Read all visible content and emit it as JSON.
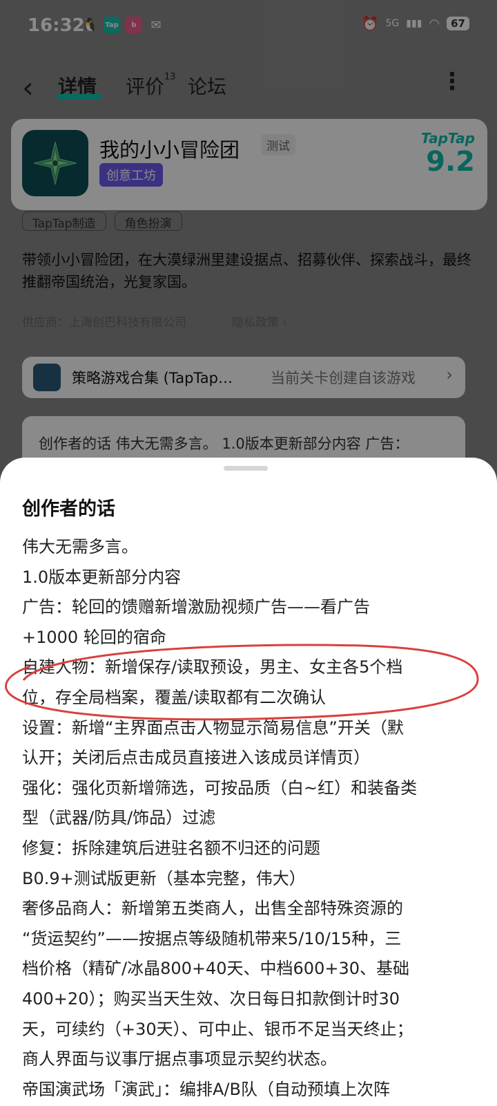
{
  "status_bar": {
    "time": "16:32",
    "battery": "67",
    "network": "5G",
    "notification_icons": [
      "qq-icon",
      "taptap-icon",
      "bilibili-icon",
      "wechat-icon"
    ]
  },
  "nav": {
    "tabs": [
      {
        "label": "详情",
        "active": true
      },
      {
        "label": "评价",
        "badge": "13"
      },
      {
        "label": "论坛"
      }
    ]
  },
  "app": {
    "name": "我的小小冒险团",
    "test_tag": "测试",
    "workshop_tag": "创意工坊",
    "brand": "TapTap",
    "score": "9.2"
  },
  "chips": [
    "TapTap制造",
    "角色扮演"
  ],
  "description": "带领小小冒险团，在大漠绿洲里建设据点、招募伙伴、探索战斗，最终推翻帝国统治，光复家国。",
  "vendor": "供应商：上海创巴科技有限公司",
  "privacy": "隐私政策 ›",
  "collection": {
    "title": "策略游戏合集 (TapTap…",
    "note": "当前关卡创建自该游戏"
  },
  "preview_text": "创作者的话  伟大无需多言。 1.0版本更新部分内容 广告：",
  "sheet": {
    "title": "创作者的话",
    "lines": [
      "伟大无需多言。",
      "1.0版本更新部分内容",
      "广告：轮回的馈赠新增激励视频广告——看广告",
      "+1000 轮回的宿命",
      "自建人物：新增保存/读取预设，男主、女主各5个档",
      "位，存全局档案，覆盖/读取都有二次确认",
      "设置：新增“主界面点击人物显示简易信息”开关（默",
      "认开；关闭后点击成员直接进入该成员详情页）",
      "强化：强化页新增筛选，可按品质（白~红）和装备类",
      "型（武器/防具/饰品）过滤",
      "修复：拆除建筑后进驻名额不归还的问题",
      "B0.9+测试版更新（基本完整，伟大）",
      "奢侈品商人：新增第五类商人，出售全部特殊资源的",
      "“货运契约”——按据点等级随机带来5/10/15种，三",
      "档价格（精矿/冰晶800+40天、中档600+30、基础",
      "400+20）；购买当天生效、次日每日扣款倒计时30",
      "天，可续约（+30天）、可中止、银币不足当天终止；",
      "商人界面与议事厅据点事项显示契约状态。",
      "帝国演武场「演武」：编排A/B队（自动预填上次阵"
    ]
  }
}
